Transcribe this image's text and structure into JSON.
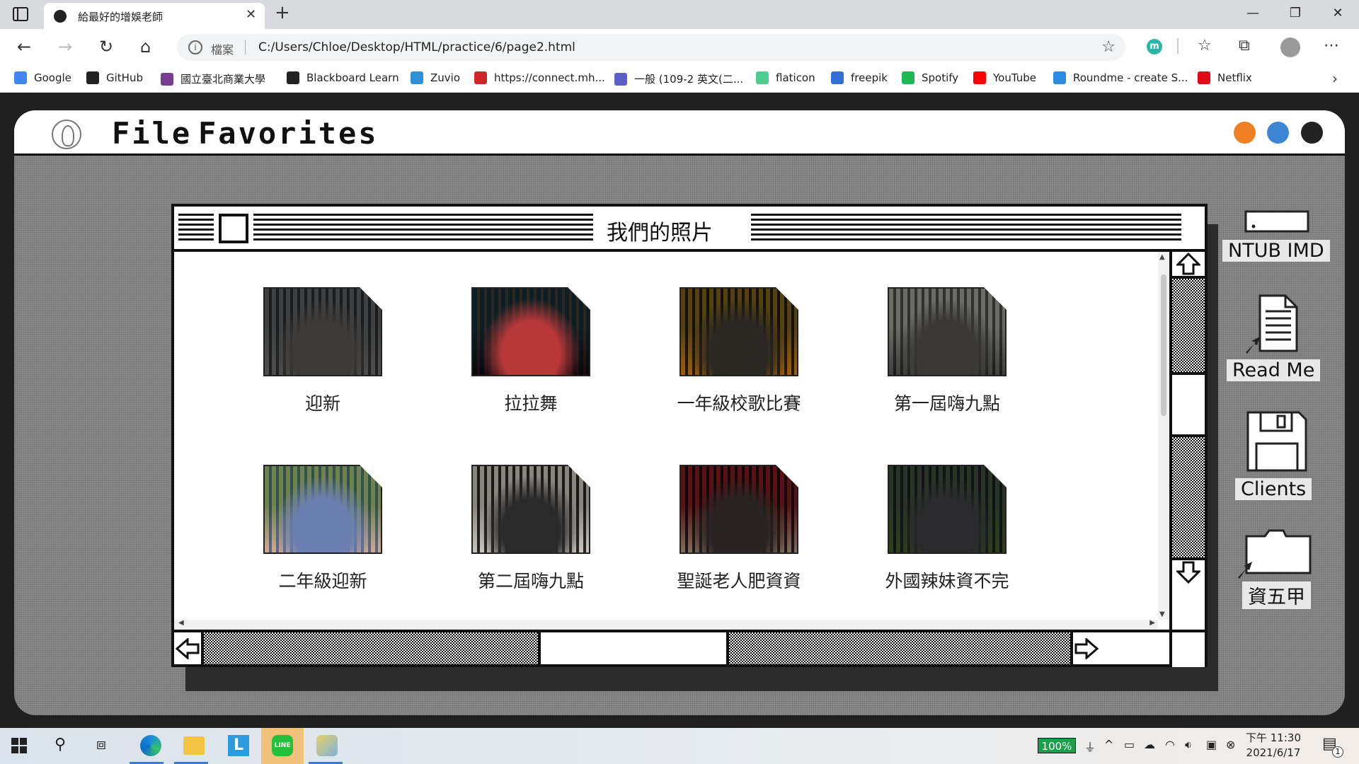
{
  "browser": {
    "tab_title": "給最好的增娛老師",
    "url_label": "檔案",
    "url": "C:/Users/Chloe/Desktop/HTML/practice/6/page2.html",
    "ext_badge": "m",
    "bookmarks": [
      {
        "label": "Google",
        "icon": "google-icon",
        "color": "#4285f4"
      },
      {
        "label": "GitHub",
        "icon": "github-icon",
        "color": "#222222"
      },
      {
        "label": "國立臺北商業大學",
        "icon": "ntub-icon",
        "color": "#7a3c8c"
      },
      {
        "label": "Blackboard Learn",
        "icon": "blackboard-icon",
        "color": "#222222"
      },
      {
        "label": "Zuvio",
        "icon": "zuvio-icon",
        "color": "#2f8fd8"
      },
      {
        "label": "https://connect.mh...",
        "icon": "mcgrawhill-icon",
        "color": "#d0262b"
      },
      {
        "label": "一般 (109-2 英文(二...",
        "icon": "teams-icon",
        "color": "#5b5fc7"
      },
      {
        "label": "flaticon",
        "icon": "flaticon-icon",
        "color": "#4ecb8f"
      },
      {
        "label": "freepik",
        "icon": "freepik-icon",
        "color": "#2f6fd6"
      },
      {
        "label": "Spotify",
        "icon": "spotify-icon",
        "color": "#1db954"
      },
      {
        "label": "YouTube",
        "icon": "youtube-icon",
        "color": "#ff0000"
      },
      {
        "label": "Roundme - create S...",
        "icon": "roundme-icon",
        "color": "#2c8be3"
      },
      {
        "label": "Netflix",
        "icon": "netflix-icon",
        "color": "#e50914"
      }
    ]
  },
  "menubar": {
    "items": [
      "File",
      "Favorites"
    ],
    "dots": [
      "#ef7f22",
      "#3d86d6",
      "#222222"
    ]
  },
  "window": {
    "title": "我們的照片",
    "photos": [
      {
        "label": "迎新",
        "colors": [
          "#6f7478",
          "#3d3a38",
          "#8c8f8e"
        ]
      },
      {
        "label": "拉拉舞",
        "colors": [
          "#3fa8a0",
          "#b8383a",
          "#2c2f36"
        ]
      },
      {
        "label": "一年級校歌比賽",
        "colors": [
          "#6a6a48",
          "#2a2722",
          "#c99a3a"
        ]
      },
      {
        "label": "第一屆嗨九點",
        "colors": [
          "#d8d8d4",
          "#3a3836",
          "#7d7f7c"
        ]
      },
      {
        "label": "二年級迎新",
        "colors": [
          "#7aa06a",
          "#6b7fb0",
          "#e6d0c2"
        ]
      },
      {
        "label": "第二屆嗨九點",
        "colors": [
          "#9a9692",
          "#2b2a2a",
          "#e2e0dc"
        ]
      },
      {
        "label": "聖誕老人肥資資",
        "colors": [
          "#7a1c22",
          "#2a2323",
          "#b3a79a"
        ]
      },
      {
        "label": "外國辣妹資不完",
        "colors": [
          "#5e6a70",
          "#2a2a2c",
          "#6d7f56"
        ]
      }
    ]
  },
  "desktop_icons": [
    {
      "label": "NTUB IMD",
      "icon": "drive-icon"
    },
    {
      "label": "Read Me",
      "icon": "document-shortcut-icon"
    },
    {
      "label": "Clients",
      "icon": "floppy-disk-icon"
    },
    {
      "label": "資五甲",
      "icon": "folder-shortcut-icon"
    }
  ],
  "taskbar": {
    "battery": "100%",
    "time": "下午 11:30",
    "date": "2021/6/17",
    "notifications": "1"
  }
}
